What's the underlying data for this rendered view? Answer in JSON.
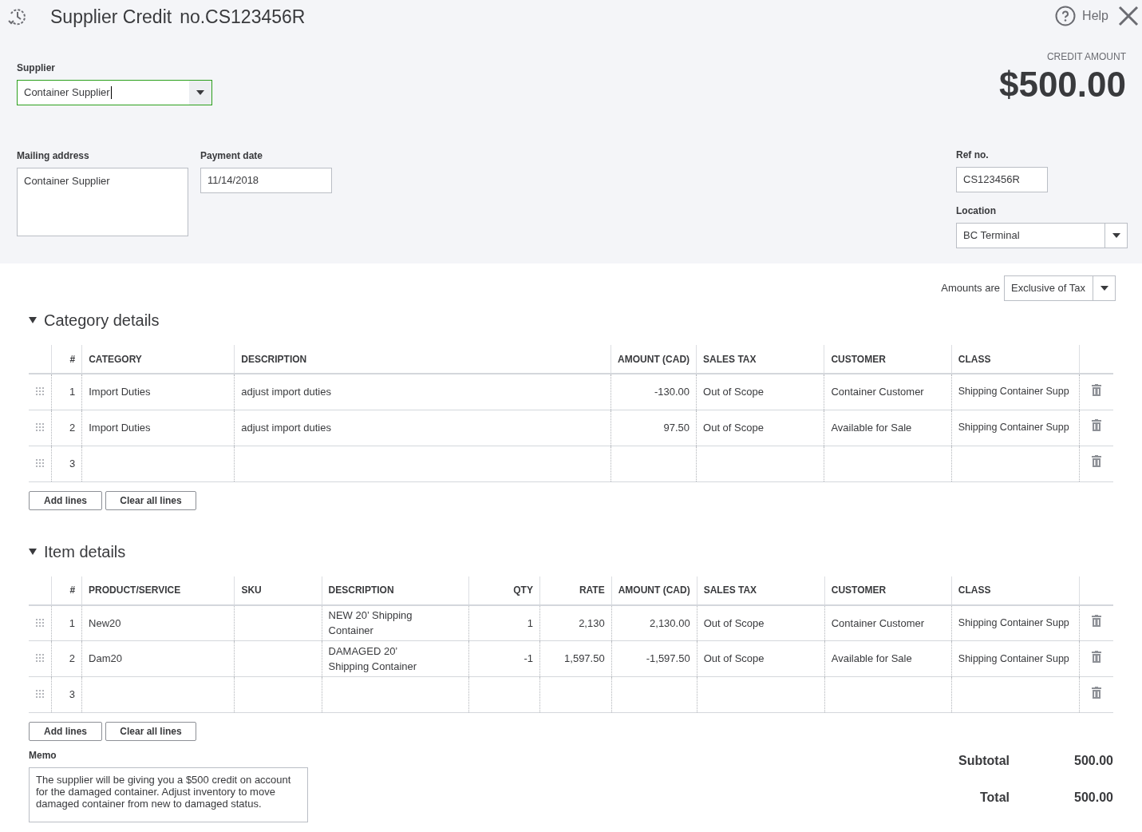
{
  "header": {
    "title": "Supplier Credit",
    "number": "no.CS123456R",
    "help": "Help"
  },
  "supplier": {
    "label": "Supplier",
    "value": "Container Supplier",
    "focused": true
  },
  "credit_amount": {
    "label": "CREDIT AMOUNT",
    "value": "$500.00"
  },
  "mailing_address": {
    "label": "Mailing address",
    "value": "Container Supplier"
  },
  "payment_date": {
    "label": "Payment date",
    "value": "11/14/2018"
  },
  "ref_no": {
    "label": "Ref no.",
    "value": "CS123456R"
  },
  "location": {
    "label": "Location",
    "value": "BC Terminal"
  },
  "amounts_are": {
    "label": "Amounts are",
    "value": "Exclusive of Tax"
  },
  "sections": [
    {
      "title": "Category details",
      "expanded": true,
      "columns": [
        {
          "label": "#",
          "kind": "number"
        },
        {
          "label": "CATEGORY",
          "kind": "text"
        },
        {
          "label": "DESCRIPTION",
          "kind": "text"
        },
        {
          "label": "AMOUNT (CAD)",
          "kind": "number"
        },
        {
          "label": "SALES TAX",
          "kind": "text"
        },
        {
          "label": "CUSTOMER",
          "kind": "text"
        },
        {
          "label": "CLASS",
          "kind": "text"
        }
      ],
      "rows": [
        {
          "cells": [
            "1",
            "Import Duties",
            "adjust import duties",
            "-130.00",
            "Out of Scope",
            "Container Customer",
            "Shipping Container Supp"
          ]
        },
        {
          "cells": [
            "2",
            "Import Duties",
            "adjust import duties",
            "97.50",
            "Out of Scope",
            "Available for Sale",
            "Shipping Container Supp"
          ]
        },
        {
          "cells": [
            "3"
          ]
        }
      ],
      "buttons": [
        "Add lines",
        "Clear all lines"
      ]
    },
    {
      "title": "Item details",
      "expanded": true,
      "columns": [
        {
          "label": "#",
          "kind": "number"
        },
        {
          "label": "PRODUCT/SERVICE",
          "kind": "text"
        },
        {
          "label": "SKU",
          "kind": "text"
        },
        {
          "label": "DESCRIPTION",
          "kind": "text"
        },
        {
          "label": "QTY",
          "kind": "number"
        },
        {
          "label": "RATE",
          "kind": "number"
        },
        {
          "label": "AMOUNT (CAD)",
          "kind": "number"
        },
        {
          "label": "SALES TAX",
          "kind": "text"
        },
        {
          "label": "CUSTOMER",
          "kind": "text"
        },
        {
          "label": "CLASS",
          "kind": "text"
        }
      ],
      "rows": [
        {
          "cells": [
            "1",
            "New20",
            null,
            "NEW 20’ Shipping Container",
            "1",
            "2,130",
            "2,130.00",
            "Out of Scope",
            "Container Customer",
            "Shipping Container Supp"
          ]
        },
        {
          "cells": [
            "2",
            "Dam20",
            null,
            "DAMAGED 20’ Shipping Container",
            "-1",
            "1,597.50",
            "-1,597.50",
            "Out of Scope",
            "Available for Sale",
            "Shipping Container Supp"
          ]
        },
        {
          "cells": [
            "3"
          ]
        }
      ],
      "buttons": [
        "Add lines",
        "Clear all lines"
      ]
    }
  ],
  "memo": {
    "label": "Memo",
    "value": "The supplier will be giving you a $500 credit on account for the damaged container. Adjust inventory to move damaged container from new to damaged status."
  },
  "totals": [
    {
      "label": "Subtotal",
      "value": "500.00"
    },
    {
      "label": "Total",
      "value": "500.00"
    }
  ]
}
